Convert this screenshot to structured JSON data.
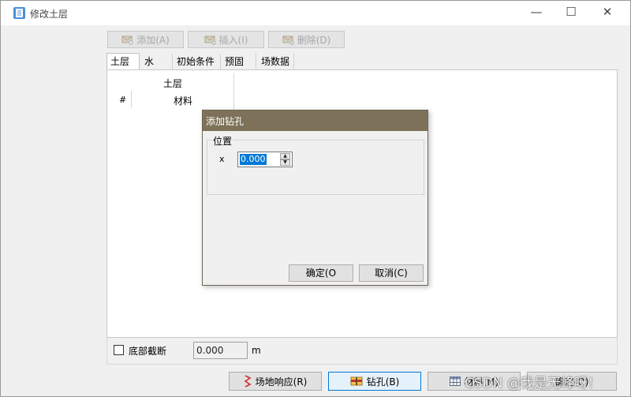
{
  "window": {
    "title": "修改土层",
    "controls": {
      "minimize": "—",
      "maximize": "☐",
      "close": "✕"
    }
  },
  "toolbar": {
    "add_label": "添加(A)",
    "insert_label": "插入(I)",
    "delete_label": "删除(D)"
  },
  "tabs": [
    {
      "label": "土层",
      "active": true
    },
    {
      "label": "水",
      "active": false
    },
    {
      "label": "初始条件",
      "active": false
    },
    {
      "label": "预固结",
      "active": false
    },
    {
      "label": "场数据",
      "active": false
    }
  ],
  "grid": {
    "header_group": "土层",
    "column_index": "#",
    "column_material": "材料"
  },
  "bottom": {
    "checkbox_label": "底部截断",
    "depth_value": "0.000",
    "depth_unit": "m"
  },
  "buttons": {
    "site_response": "场地响应(R)",
    "borehole": "钻孔(B)",
    "materials": "材料(M)",
    "ok": "确定(O)"
  },
  "watermark": "CSDN @我是无峰呀！",
  "dialog": {
    "title": "添加钻孔",
    "group_label": "位置",
    "x_label": "x",
    "x_value": "0.000",
    "ok_label": "确定(O",
    "cancel_label": "取消(C)"
  },
  "colors": {
    "dialog_titlebar": "#7d7259",
    "selection": "#0078d7",
    "focus_border": "#0078d7"
  },
  "icons": {
    "app": "document-app-icon",
    "add": "add-envelope-icon",
    "insert": "insert-envelope-icon",
    "delete": "delete-envelope-icon",
    "site_response": "zigzag-icon",
    "borehole": "borehole-icon",
    "materials": "table-icon"
  }
}
